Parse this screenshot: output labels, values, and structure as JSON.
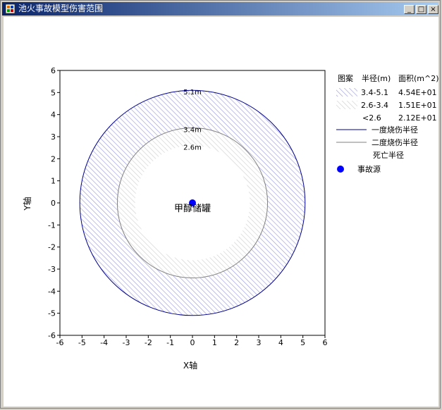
{
  "window": {
    "title": "池火事故模型伤害范围",
    "minimize_glyph": "_",
    "maximize_glyph": "□",
    "close_glyph": "×"
  },
  "legend": {
    "header_pattern": "图案",
    "header_radius": "半径(m)",
    "header_area": "面积(m^2)",
    "rows": [
      {
        "radius": "3.4-5.1",
        "area": "4.54E+01"
      },
      {
        "radius": "2.6-3.4",
        "area": "1.51E+01"
      },
      {
        "radius": "<2.6",
        "area": "2.12E+01"
      }
    ],
    "line_items": [
      "一度烧伤半径",
      "二度烧伤半径",
      "死亡半径"
    ],
    "source_label": "事故源"
  },
  "chart_data": {
    "type": "scatter",
    "xlabel": "X轴",
    "ylabel": "Y轴",
    "xlim": [
      -6,
      6
    ],
    "ylim": [
      -6,
      6
    ],
    "xticks": [
      -6,
      -5,
      -4,
      -3,
      -2,
      -1,
      0,
      1,
      2,
      3,
      4,
      5,
      6
    ],
    "yticks": [
      -6,
      -5,
      -4,
      -3,
      -2,
      -1,
      0,
      1,
      2,
      3,
      4,
      5,
      6
    ],
    "circles": [
      {
        "radius": 5.1,
        "label": "5.1m",
        "color": "#00008b"
      },
      {
        "radius": 3.4,
        "label": "3.4m",
        "color": "#808080"
      },
      {
        "radius": 2.6,
        "label": "2.6m",
        "color": ""
      }
    ],
    "source": {
      "x": 0,
      "y": 0,
      "label": "甲醇储罐",
      "color": "#0000ff"
    }
  }
}
